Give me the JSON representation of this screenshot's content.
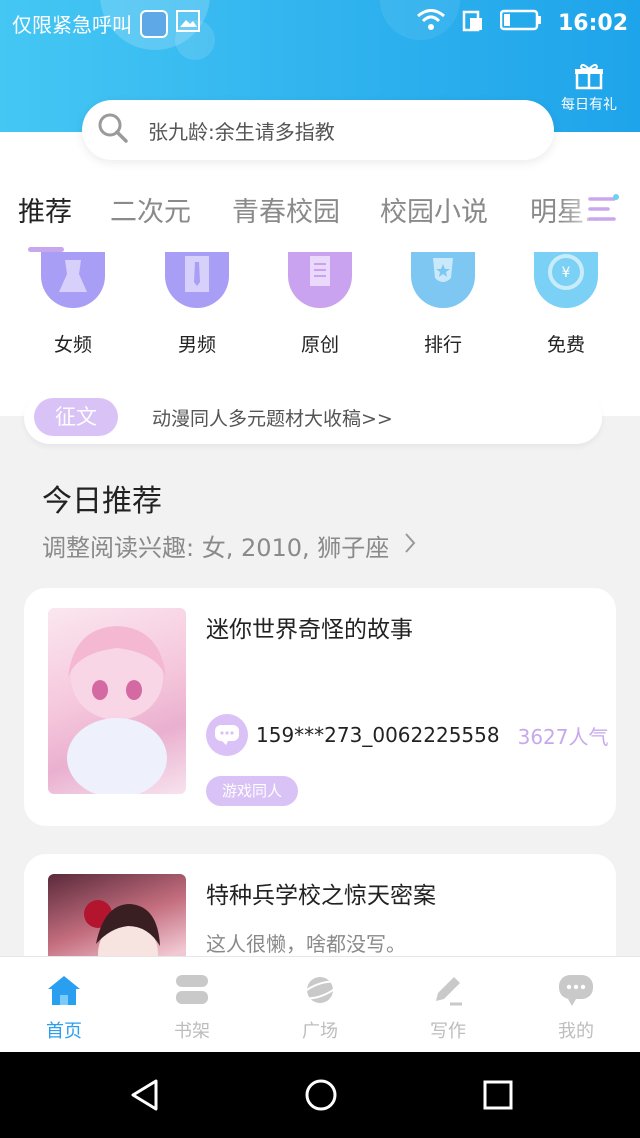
{
  "status_bar": {
    "carrier": "仅限紧急呼叫",
    "time": "16:02"
  },
  "header": {
    "gift_label": "每日有礼"
  },
  "search": {
    "placeholder": "张九龄:余生请多指教"
  },
  "tabs": [
    {
      "label": "推荐"
    },
    {
      "label": "二次元"
    },
    {
      "label": "青春校园"
    },
    {
      "label": "校园小说"
    },
    {
      "label": "明星..."
    }
  ],
  "categories": [
    {
      "label": "女频",
      "color": "#a99ef5"
    },
    {
      "label": "男频",
      "color": "#a99ef5"
    },
    {
      "label": "原创",
      "color": "#c9a3f0"
    },
    {
      "label": "排行",
      "color": "#7ec7f2"
    },
    {
      "label": "免费",
      "color": "#7ad0f5"
    }
  ],
  "banner": {
    "badge": "征文",
    "text": "动漫同人多元题材大收稿>>"
  },
  "recommend": {
    "title": "今日推荐",
    "subtitle": "调整阅读兴趣: 女, 2010, 狮子座"
  },
  "books": [
    {
      "title": "迷你世界奇怪的故事",
      "author": "159***273_0062225558",
      "popularity": "3627人气",
      "tag": "游戏同人"
    },
    {
      "title": "特种兵学校之惊天密案",
      "description": "这人很懒，啥都没写。"
    }
  ],
  "bottom_nav": [
    {
      "label": "首页",
      "icon": "home-icon",
      "active": true
    },
    {
      "label": "书架",
      "icon": "bookshelf-icon"
    },
    {
      "label": "广场",
      "icon": "planet-icon"
    },
    {
      "label": "写作",
      "icon": "pen-icon"
    },
    {
      "label": "我的",
      "icon": "chat-bubble-icon"
    }
  ],
  "colors": {
    "header_blue": "#2fb2ee",
    "accent_purple": "#d9c2f5",
    "nav_active": "#2a9ef0"
  }
}
